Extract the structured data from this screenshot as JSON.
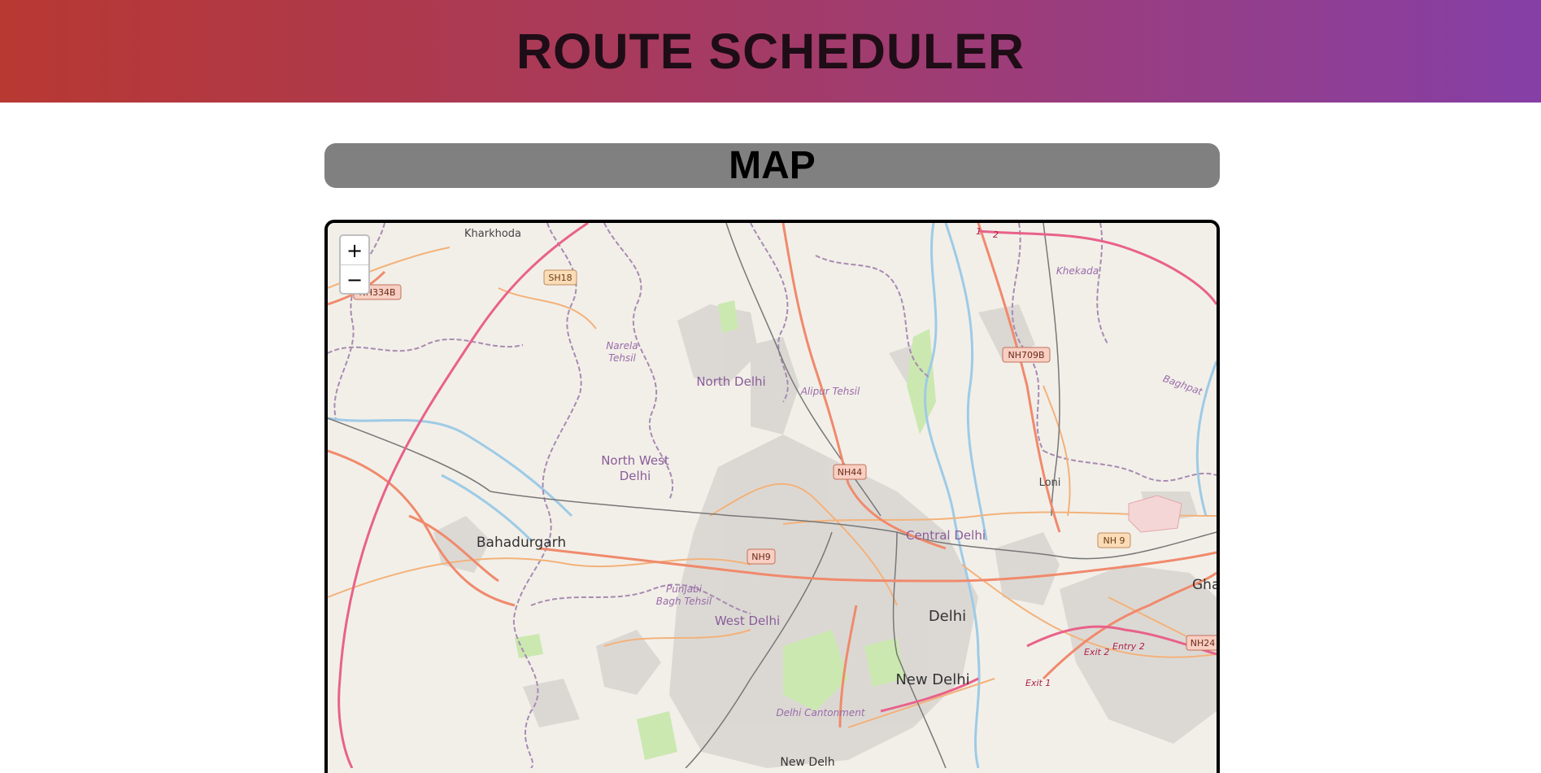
{
  "header": {
    "title": "ROUTE SCHEDULER"
  },
  "section": {
    "map_title": "MAP"
  },
  "map": {
    "zoom_in_label": "+",
    "zoom_out_label": "−",
    "places": {
      "kharkhoda": "Kharkhoda",
      "narela": "Narela",
      "tehsil": "Tehsil",
      "north_delhi": "North Delhi",
      "alipur": "Alipur Tehsil",
      "north_west": "North West",
      "delhi_word": "Delhi",
      "bahadurgarh": "Bahadurgarh",
      "central_delhi": "Central Delhi",
      "punjabi": "Punjabi",
      "bagh_tehsil": "Bagh Tehsil",
      "west_delhi": "West Delhi",
      "delhi": "Delhi",
      "new_delhi": "New Delhi",
      "delhi_cantonment": "Delhi Cantonment",
      "loni": "Loni",
      "khekada": "Khekada",
      "baghpat": "Baghpat",
      "gha": "Gha",
      "new_delhi_partial": "New Delh"
    },
    "road_shields": {
      "sh18": "SH18",
      "nh334b": "NH334B",
      "nh709b": "NH709B",
      "nh44": "NH44",
      "nh9_west": "NH9",
      "nh9_east": "NH 9",
      "nh24": "NH24"
    },
    "exits": {
      "exit2": "Exit 2",
      "entry2": "Entry 2",
      "exit1": "Exit 1",
      "one": "1",
      "two": "2"
    },
    "colors": {
      "land": "#f2efe9",
      "motorway": "#e8628a",
      "trunk": "#f08a6c",
      "primary": "#f3b27a",
      "boundary": "#a88bb0",
      "river": "#9ecbe6",
      "urban": "#d6d3cf",
      "park": "#cbe8b0"
    }
  }
}
